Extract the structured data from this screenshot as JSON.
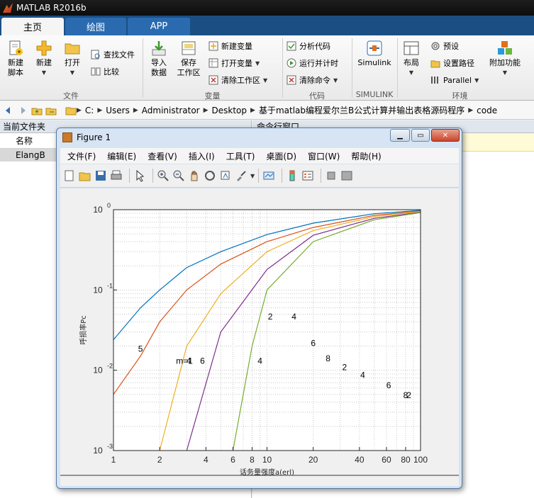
{
  "app": {
    "title": "MATLAB R2016b"
  },
  "tabs": [
    {
      "label": "主页"
    },
    {
      "label": "绘图"
    },
    {
      "label": "APP"
    }
  ],
  "ribbon": {
    "file": {
      "new_script": "新建\n脚本",
      "new": "新建",
      "open": "打开",
      "find_files": "查找文件",
      "compare": "比较",
      "section": "文件"
    },
    "variable": {
      "import_data": "导入\n数据",
      "save_workspace": "保存\n工作区",
      "new_variable": "新建变量",
      "open_variable": "打开变量",
      "clear_workspace": "清除工作区",
      "section": "变量"
    },
    "code": {
      "analyze_code": "分析代码",
      "run_and_time": "运行并计时",
      "clear_commands": "清除命令",
      "section": "代码"
    },
    "simulink": {
      "simulink": "Simulink",
      "section": "SIMULINK"
    },
    "environment": {
      "layout": "布局",
      "preferences": "预设",
      "set_path": "设置路径",
      "parallel": "Parallel",
      "addons": "附加功能",
      "section": "环境"
    }
  },
  "address": {
    "crumbs": [
      "C:",
      "Users",
      "Administrator",
      "Desktop",
      "基于matlab编程爱尔兰B公式计算并输出表格源码程序",
      "code"
    ]
  },
  "current_folder": {
    "title": "当前文件夹",
    "column_name": "名称",
    "file": "ElangB"
  },
  "command_window": {
    "title": "命令行窗口"
  },
  "figure": {
    "title": "Figure 1",
    "menu": [
      "文件(F)",
      "编辑(E)",
      "查看(V)",
      "插入(I)",
      "工具(T)",
      "桌面(D)",
      "窗口(W)",
      "帮助(H)"
    ]
  },
  "chart_data": {
    "type": "line",
    "xscale": "log",
    "yscale": "log",
    "xlim": [
      1,
      100
    ],
    "ylim": [
      0.001,
      1
    ],
    "xlabel": "话务量强度a(erl)",
    "ylabel": "呼损率Pc",
    "xticks": [
      "1",
      "2",
      "4",
      "6",
      "8",
      "10",
      "20",
      "40",
      "60",
      "80",
      "100"
    ],
    "yticks": [
      "10^0",
      "10^-1",
      "10^-2",
      "10^-3"
    ],
    "grid": true,
    "colors": [
      "#0072bd",
      "#d95319",
      "#edb120",
      "#7e2f8e",
      "#77ac30",
      "#4dbeee",
      "#a2142f"
    ],
    "series": [
      {
        "m": 1,
        "x": [
          1,
          1.5,
          2,
          3,
          5,
          10,
          20,
          50,
          100
        ],
        "y": [
          0.024,
          0.06,
          0.1,
          0.19,
          0.3,
          0.49,
          0.68,
          0.89,
          0.98
        ]
      },
      {
        "m": 2,
        "x": [
          1,
          1.5,
          2,
          3,
          5,
          10,
          20,
          50,
          100
        ],
        "y": [
          0.005,
          0.015,
          0.04,
          0.1,
          0.21,
          0.4,
          0.6,
          0.85,
          0.96
        ]
      },
      {
        "m": 3,
        "x": [
          2,
          3,
          5,
          10,
          20,
          50,
          100
        ],
        "y": [
          0.001,
          0.02,
          0.09,
          0.3,
          0.55,
          0.82,
          0.95
        ]
      },
      {
        "m": 4,
        "x": [
          3,
          5,
          10,
          20,
          50,
          100
        ],
        "y": [
          0.001,
          0.03,
          0.18,
          0.48,
          0.78,
          0.93
        ]
      },
      {
        "m": 5,
        "x": [
          6,
          8,
          10,
          20,
          50,
          100
        ],
        "y": [
          0.001,
          0.02,
          0.1,
          0.4,
          0.75,
          0.92
        ]
      }
    ],
    "annotations": [
      {
        "text": "5",
        "x": 1.5,
        "y": 0.017
      },
      {
        "text": "m=1",
        "x": 2.9,
        "y": 0.012
      },
      {
        "text": "4",
        "x": 3.1,
        "y": 0.012
      },
      {
        "text": "6",
        "x": 3.8,
        "y": 0.012
      },
      {
        "text": "2",
        "x": 10.5,
        "y": 0.043
      },
      {
        "text": "4",
        "x": 15,
        "y": 0.043
      },
      {
        "text": "4",
        "x": 9,
        "y": 0.012
      },
      {
        "text": "6",
        "x": 20,
        "y": 0.02
      },
      {
        "text": "8",
        "x": 25,
        "y": 0.013
      },
      {
        "text": "2",
        "x": 32,
        "y": 0.01
      },
      {
        "text": "4",
        "x": 42,
        "y": 0.008
      },
      {
        "text": "6",
        "x": 62,
        "y": 0.006
      },
      {
        "text": "8",
        "x": 80,
        "y": 0.0045
      },
      {
        "text": "2",
        "x": 84,
        "y": 0.0045
      }
    ]
  }
}
